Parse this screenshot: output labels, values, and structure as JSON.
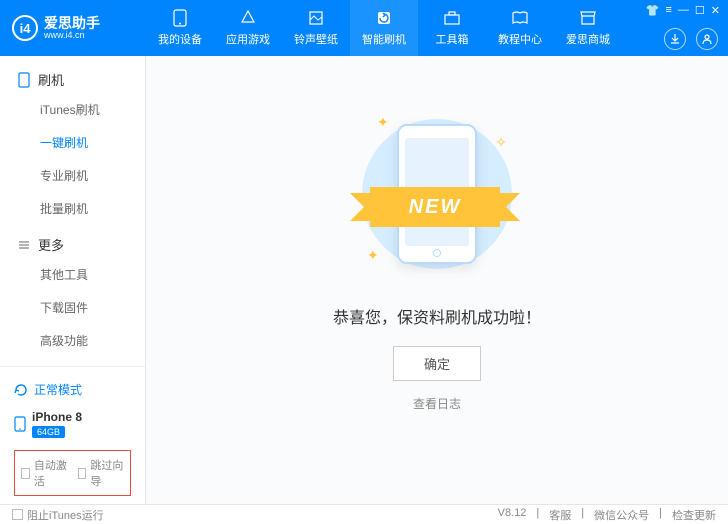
{
  "app": {
    "name": "爱思助手",
    "url": "www.i4.cn",
    "logo_text": "i4"
  },
  "nav": [
    {
      "label": "我的设备"
    },
    {
      "label": "应用游戏"
    },
    {
      "label": "铃声壁纸"
    },
    {
      "label": "智能刷机"
    },
    {
      "label": "工具箱"
    },
    {
      "label": "教程中心"
    },
    {
      "label": "爱思商城"
    }
  ],
  "sidebar": {
    "groups": [
      {
        "title": "刷机",
        "items": [
          "iTunes刷机",
          "一键刷机",
          "专业刷机",
          "批量刷机"
        ]
      },
      {
        "title": "更多",
        "items": [
          "其他工具",
          "下载固件",
          "高级功能"
        ]
      }
    ],
    "mode": "正常模式",
    "device": {
      "name": "iPhone 8",
      "storage": "64GB"
    },
    "checks": [
      "自动激活",
      "跳过向导"
    ]
  },
  "main": {
    "banner": "NEW",
    "message": "恭喜您，保资料刷机成功啦！",
    "confirm": "确定",
    "log_link": "查看日志"
  },
  "statusbar": {
    "block_itunes": "阻止iTunes运行",
    "version": "V8.12",
    "links": [
      "客服",
      "微信公众号",
      "检查更新"
    ]
  }
}
